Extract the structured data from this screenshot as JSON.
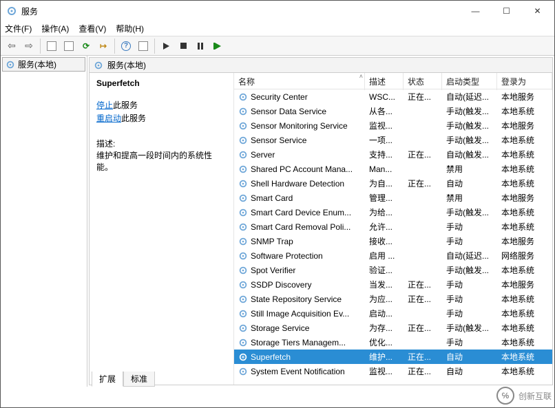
{
  "title": "服务",
  "window_ctrl": {
    "min": "—",
    "max": "☐",
    "close": "✕"
  },
  "menu": {
    "file": "文件(F)",
    "action": "操作(A)",
    "view": "查看(V)",
    "help": "帮助(H)"
  },
  "tree_root": "服务(本地)",
  "pane_header": "服务(本地)",
  "detail": {
    "selected_name": "Superfetch",
    "stop_link": "停止",
    "stop_suffix": "此服务",
    "restart_link": "重启动",
    "restart_suffix": "此服务",
    "desc_label": "描述:",
    "desc_body": "维护和提高一段时间内的系统性能。"
  },
  "columns": {
    "c0": "名称",
    "c1": "描述",
    "c2": "状态",
    "c3": "启动类型",
    "c4": "登录为"
  },
  "tabs": {
    "extended": "扩展",
    "standard": "标准"
  },
  "watermark_text": "创新互联",
  "rows": [
    {
      "name": "Security Center",
      "desc": "WSC...",
      "status": "正在...",
      "startup": "自动(延迟...",
      "logon": "本地服务",
      "sel": false
    },
    {
      "name": "Sensor Data Service",
      "desc": "从各...",
      "status": "",
      "startup": "手动(触发...",
      "logon": "本地系统",
      "sel": false
    },
    {
      "name": "Sensor Monitoring Service",
      "desc": "监视...",
      "status": "",
      "startup": "手动(触发...",
      "logon": "本地服务",
      "sel": false
    },
    {
      "name": "Sensor Service",
      "desc": "一项...",
      "status": "",
      "startup": "手动(触发...",
      "logon": "本地系统",
      "sel": false
    },
    {
      "name": "Server",
      "desc": "支持...",
      "status": "正在...",
      "startup": "自动(触发...",
      "logon": "本地系统",
      "sel": false
    },
    {
      "name": "Shared PC Account Mana...",
      "desc": "Man...",
      "status": "",
      "startup": "禁用",
      "logon": "本地系统",
      "sel": false
    },
    {
      "name": "Shell Hardware Detection",
      "desc": "为自...",
      "status": "正在...",
      "startup": "自动",
      "logon": "本地系统",
      "sel": false
    },
    {
      "name": "Smart Card",
      "desc": "管理...",
      "status": "",
      "startup": "禁用",
      "logon": "本地服务",
      "sel": false
    },
    {
      "name": "Smart Card Device Enum...",
      "desc": "为给...",
      "status": "",
      "startup": "手动(触发...",
      "logon": "本地系统",
      "sel": false
    },
    {
      "name": "Smart Card Removal Poli...",
      "desc": "允许...",
      "status": "",
      "startup": "手动",
      "logon": "本地系统",
      "sel": false
    },
    {
      "name": "SNMP Trap",
      "desc": "接收...",
      "status": "",
      "startup": "手动",
      "logon": "本地服务",
      "sel": false
    },
    {
      "name": "Software Protection",
      "desc": "启用 ...",
      "status": "",
      "startup": "自动(延迟...",
      "logon": "网络服务",
      "sel": false
    },
    {
      "name": "Spot Verifier",
      "desc": "验证...",
      "status": "",
      "startup": "手动(触发...",
      "logon": "本地系统",
      "sel": false
    },
    {
      "name": "SSDP Discovery",
      "desc": "当发...",
      "status": "正在...",
      "startup": "手动",
      "logon": "本地服务",
      "sel": false
    },
    {
      "name": "State Repository Service",
      "desc": "为应...",
      "status": "正在...",
      "startup": "手动",
      "logon": "本地系统",
      "sel": false
    },
    {
      "name": "Still Image Acquisition Ev...",
      "desc": "启动...",
      "status": "",
      "startup": "手动",
      "logon": "本地系统",
      "sel": false
    },
    {
      "name": "Storage Service",
      "desc": "为存...",
      "status": "正在...",
      "startup": "手动(触发...",
      "logon": "本地系统",
      "sel": false
    },
    {
      "name": "Storage Tiers Managem...",
      "desc": "优化...",
      "status": "",
      "startup": "手动",
      "logon": "本地系统",
      "sel": false
    },
    {
      "name": "Superfetch",
      "desc": "维护...",
      "status": "正在...",
      "startup": "自动",
      "logon": "本地系统",
      "sel": true
    },
    {
      "name": "System Event Notification",
      "desc": "监视...",
      "status": "正在...",
      "startup": "自动",
      "logon": "本地系统",
      "sel": false
    }
  ]
}
